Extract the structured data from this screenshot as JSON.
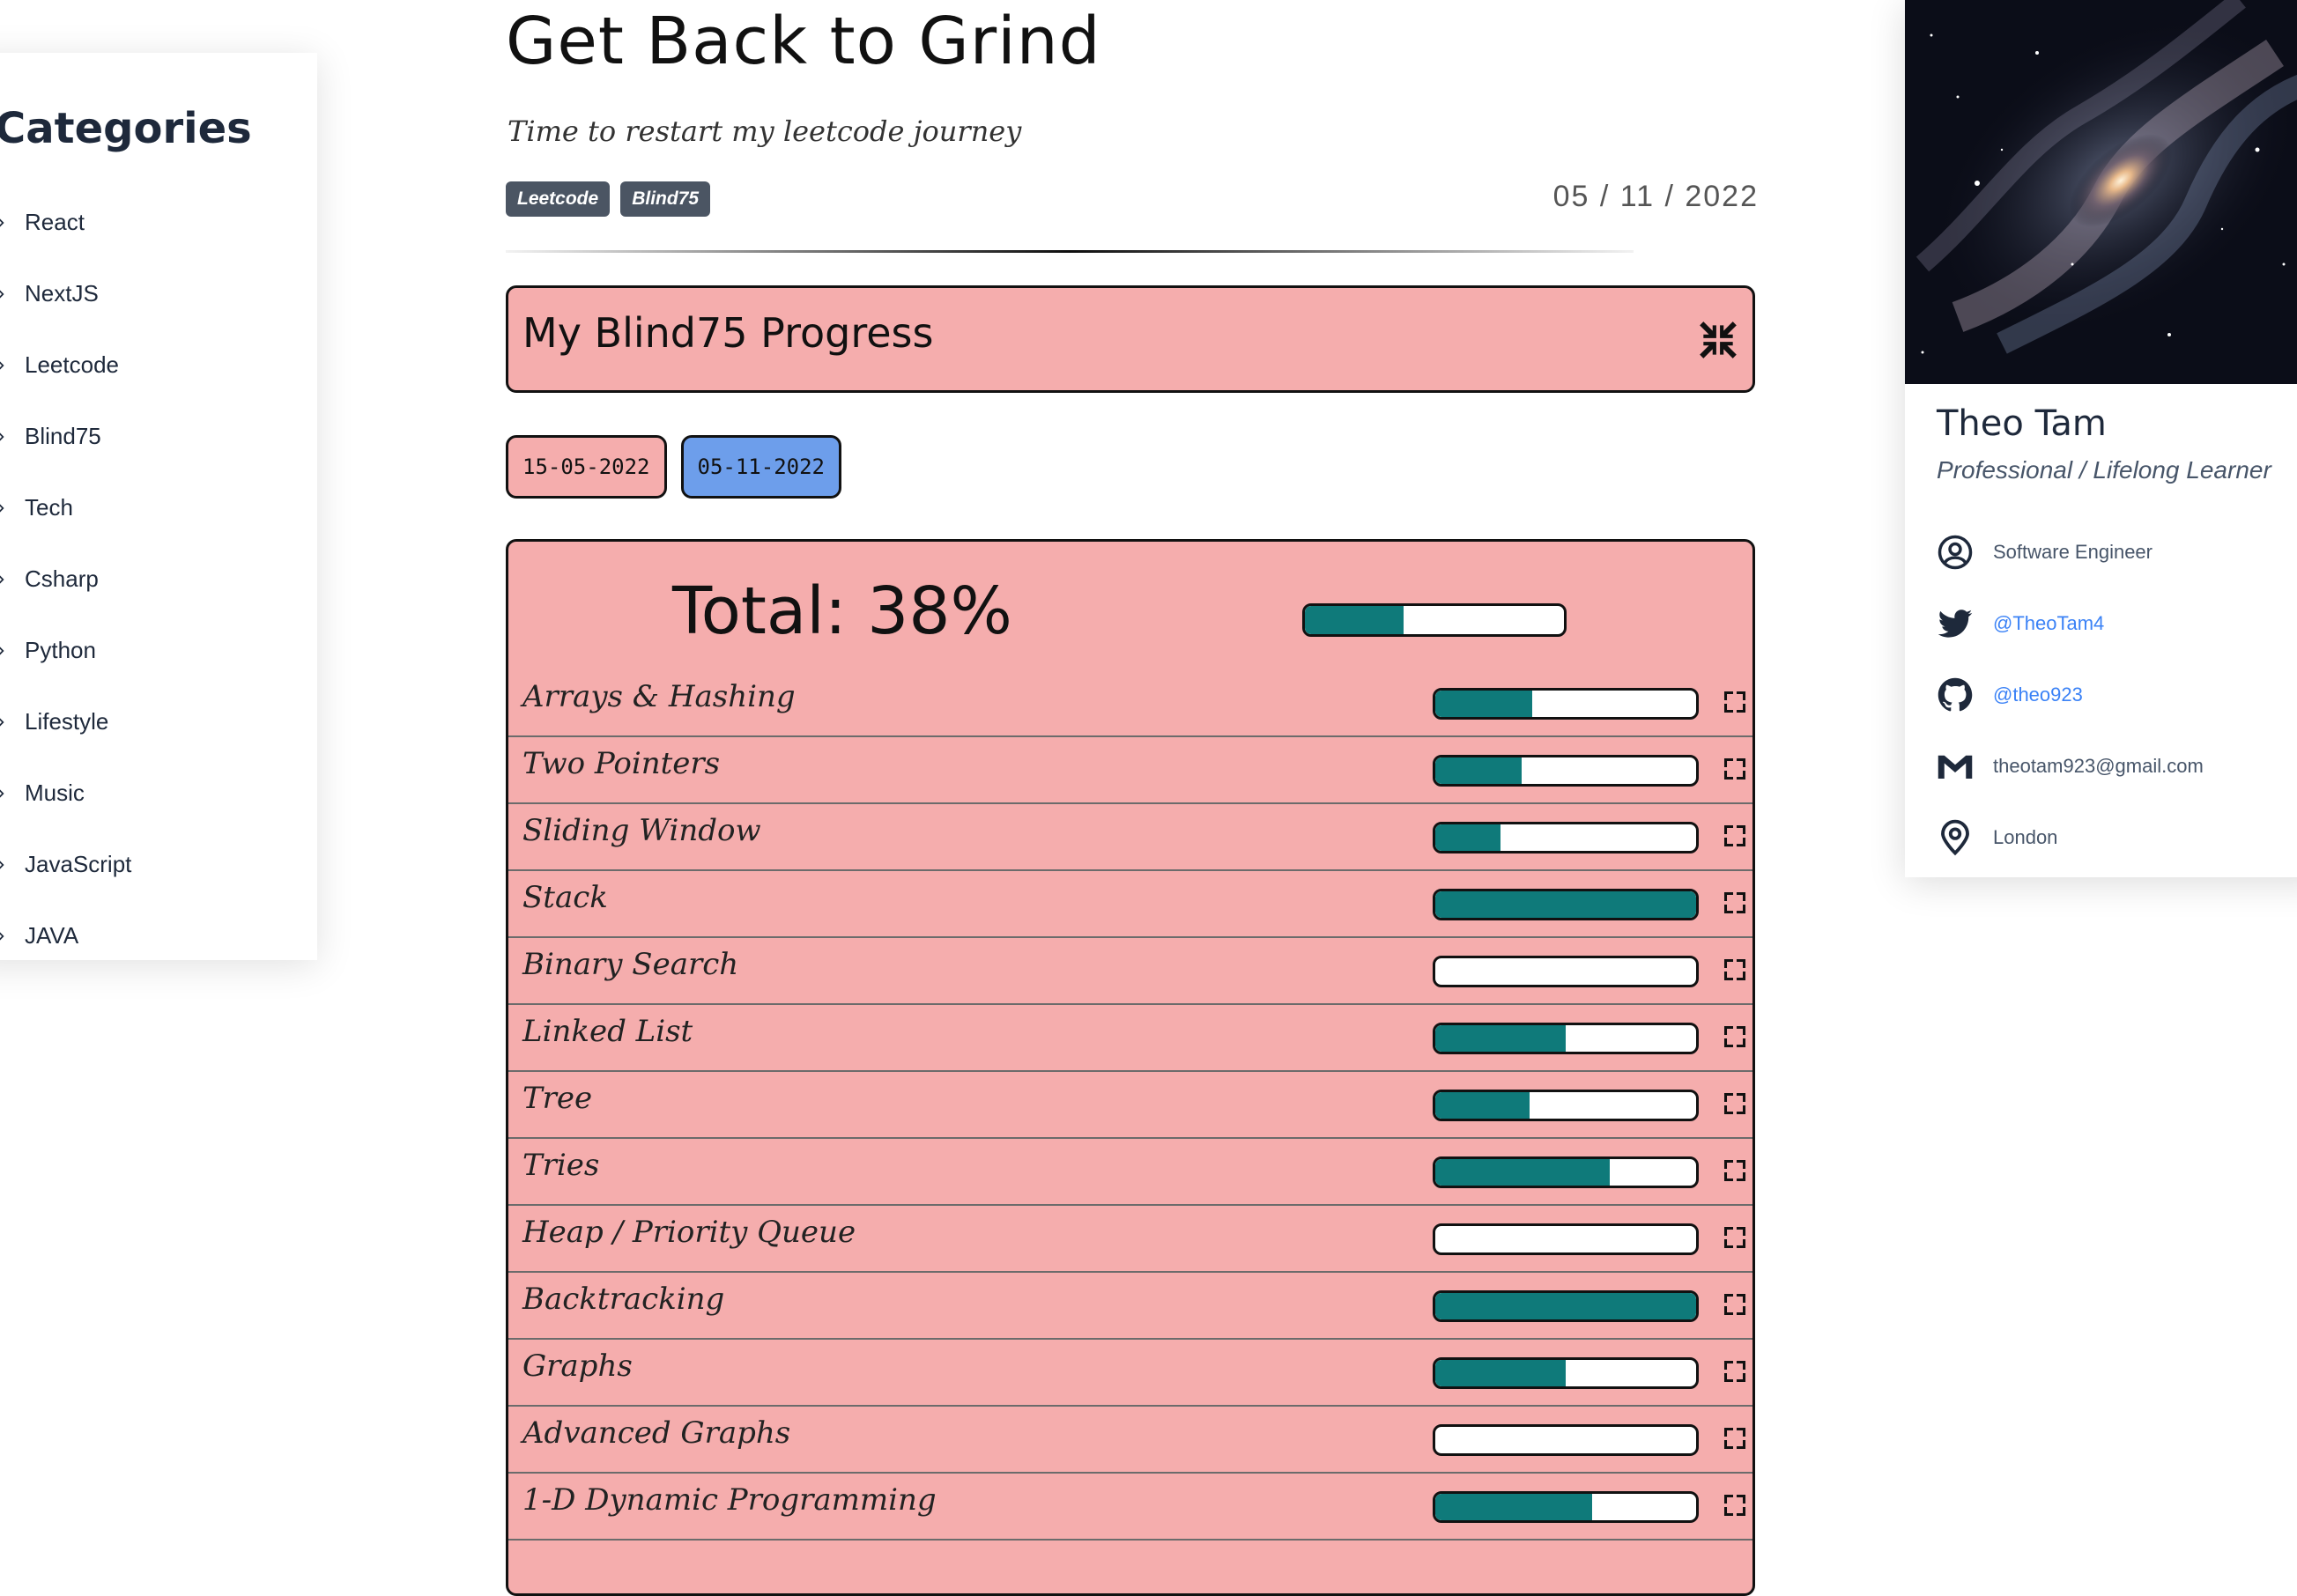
{
  "categories": {
    "title": "Categories",
    "items": [
      "React",
      "NextJS",
      "Leetcode",
      "Blind75",
      "Tech",
      "Csharp",
      "Python",
      "Lifestyle",
      "Music",
      "JavaScript",
      "JAVA"
    ]
  },
  "post": {
    "title": "Get Back to Grind",
    "subtitle": "Time to restart my leetcode journey",
    "tags": [
      "Leetcode",
      "Blind75"
    ],
    "date": "05 / 11 / 2022",
    "colors": {
      "tag_bg": "#4b5563",
      "panel_bg": "#f5adad",
      "bar_fill": "#0f7a7a",
      "active_tab_bg": "#6d9eeb"
    }
  },
  "progress_header": {
    "title": "My Blind75 Progress",
    "icon": "collapse-arrows-icon"
  },
  "date_tabs": [
    {
      "label": "15-05-2022",
      "active": false
    },
    {
      "label": "05-11-2022",
      "active": true
    }
  ],
  "progress": {
    "total_label": "Total: 38%",
    "total_percent": 38,
    "topics": [
      {
        "name": "Arrays & Hashing",
        "percent": 37
      },
      {
        "name": "Two Pointers",
        "percent": 33
      },
      {
        "name": "Sliding Window",
        "percent": 25
      },
      {
        "name": "Stack",
        "percent": 100
      },
      {
        "name": "Binary Search",
        "percent": 0
      },
      {
        "name": "Linked List",
        "percent": 50
      },
      {
        "name": "Tree",
        "percent": 36
      },
      {
        "name": "Tries",
        "percent": 67
      },
      {
        "name": "Heap / Priority Queue",
        "percent": 0
      },
      {
        "name": "Backtracking",
        "percent": 100
      },
      {
        "name": "Graphs",
        "percent": 50
      },
      {
        "name": "Advanced Graphs",
        "percent": 0
      },
      {
        "name": "1-D Dynamic Programming",
        "percent": 60
      }
    ]
  },
  "profile": {
    "name": "Theo Tam",
    "role": "Professional / Lifelong Learner",
    "contacts": [
      {
        "icon": "user-circle-icon",
        "text": "Software Engineer",
        "link": false
      },
      {
        "icon": "twitter-icon",
        "text": "@TheoTam4",
        "link": true
      },
      {
        "icon": "github-icon",
        "text": "@theo923",
        "link": true
      },
      {
        "icon": "gmail-icon",
        "text": "theotam923@gmail.com",
        "link": false
      },
      {
        "icon": "location-pin-icon",
        "text": "London",
        "link": false
      }
    ]
  }
}
